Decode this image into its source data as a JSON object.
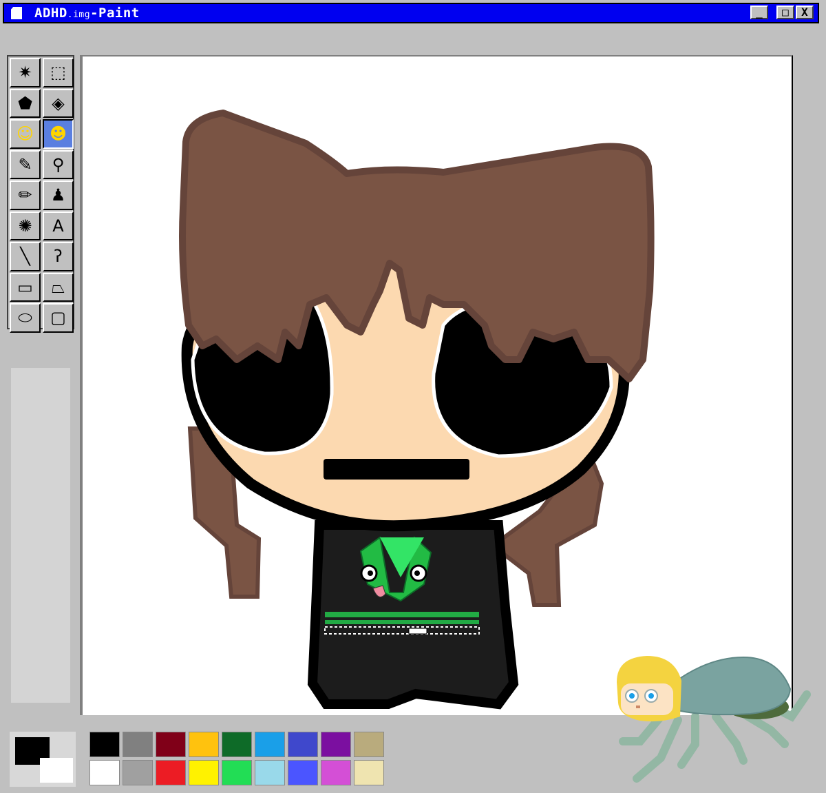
{
  "window": {
    "title_main": "ADHD",
    "title_sub": ".img",
    "title_app": "-Paint",
    "buttons": {
      "minimize": "_",
      "maximize": "□",
      "close": "X"
    }
  },
  "toolbox": {
    "tools": [
      {
        "name": "free-form-select-tool",
        "glyph": "✷"
      },
      {
        "name": "rect-select-tool",
        "glyph": "⬚"
      },
      {
        "name": "eraser-tool",
        "glyph": "⬟"
      },
      {
        "name": "fill-bucket-tool",
        "glyph": "◈"
      },
      {
        "name": "smiley-tool",
        "glyph": "☺"
      },
      {
        "name": "smiley-sticker-tool",
        "glyph": "☻",
        "active": true
      },
      {
        "name": "color-picker-tool",
        "glyph": "✎"
      },
      {
        "name": "magnifier-tool",
        "glyph": "⚲"
      },
      {
        "name": "pencil-tool",
        "glyph": "✏"
      },
      {
        "name": "brush-tool",
        "glyph": "♟"
      },
      {
        "name": "airbrush-tool",
        "glyph": "✺"
      },
      {
        "name": "text-tool",
        "glyph": "A"
      },
      {
        "name": "line-tool",
        "glyph": "╲"
      },
      {
        "name": "curve-tool",
        "glyph": "ʔ"
      },
      {
        "name": "rectangle-tool",
        "glyph": "▭"
      },
      {
        "name": "polygon-tool",
        "glyph": "⏢"
      },
      {
        "name": "ellipse-tool",
        "glyph": "⬭"
      },
      {
        "name": "rounded-rect-tool",
        "glyph": "▢"
      }
    ]
  },
  "colors": {
    "foreground": "#000000",
    "background": "#ffffff",
    "palette": [
      "#000000",
      "#808080",
      "#800018",
      "#ffc20e",
      "#0e6b28",
      "#1a9fe8",
      "#3f48cc",
      "#7b0fa0",
      "#b9ab7d",
      "#ffffff",
      "#a0a0a0",
      "#ec1c24",
      "#fff200",
      "#22dd55",
      "#99d9ea",
      "#4b55ff",
      "#d44fd6",
      "#efe4b0"
    ]
  }
}
